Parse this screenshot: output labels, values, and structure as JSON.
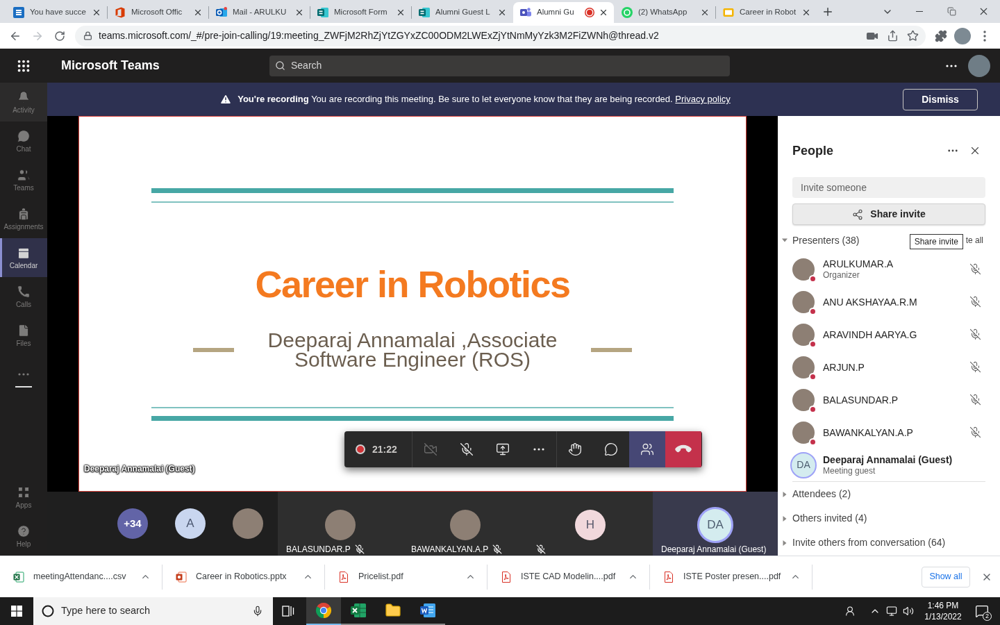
{
  "browser": {
    "tabs": [
      {
        "kind": "sway",
        "title": "You have succe",
        "selected": false,
        "recording": false
      },
      {
        "kind": "office",
        "title": "Microsoft Offic",
        "selected": false,
        "recording": false
      },
      {
        "kind": "outlook",
        "title": "Mail - ARULKU",
        "selected": false,
        "recording": false
      },
      {
        "kind": "forms",
        "title": "Microsoft Form",
        "selected": false,
        "recording": false
      },
      {
        "kind": "forms",
        "title": "Alumni Guest L",
        "selected": false,
        "recording": false
      },
      {
        "kind": "teams",
        "title": "Alumni Gu",
        "selected": true,
        "recording": true
      },
      {
        "kind": "whatsapp",
        "title": "(2) WhatsApp",
        "selected": false,
        "recording": false
      },
      {
        "kind": "slides",
        "title": "Career in Robot",
        "selected": false,
        "recording": false
      }
    ],
    "url": "teams.microsoft.com/_#/pre-join-calling/19:meeting_ZWFjM2RhZjYtZGYxZC00ODM2LWExZjYtNmMyYzk3M2FiZWNh@thread.v2"
  },
  "teams": {
    "app_name": "Microsoft Teams",
    "search": {
      "placeholder": "Search"
    },
    "rail": [
      {
        "kind": "activity",
        "label": "Activity",
        "selected": false,
        "hovered": true
      },
      {
        "kind": "chat",
        "label": "Chat",
        "selected": false,
        "hovered": false
      },
      {
        "kind": "teams",
        "label": "Teams",
        "selected": false,
        "hovered": false
      },
      {
        "kind": "assignments",
        "label": "Assignments",
        "selected": false,
        "hovered": false
      },
      {
        "kind": "calendar",
        "label": "Calendar",
        "selected": true,
        "hovered": false
      },
      {
        "kind": "calls",
        "label": "Calls",
        "selected": false,
        "hovered": false
      },
      {
        "kind": "files",
        "label": "Files",
        "selected": false,
        "hovered": false
      }
    ],
    "rail_bottom": [
      {
        "kind": "apps",
        "label": "Apps",
        "selected": false,
        "hovered": false
      },
      {
        "kind": "help",
        "label": "Help",
        "selected": false,
        "hovered": false
      }
    ]
  },
  "banner": {
    "text": "**You're recording** You are recording this meeting. Be sure to let everyone know that they are being recorded.",
    "link": "Privacy policy",
    "button": "Dismiss"
  },
  "stage": {
    "slide": {
      "title": "Career in Robotics",
      "subtitle": "Deeparaj Annamalai ,Associate Software Engineer (ROS)"
    },
    "presenter_label": "Deeparaj Annamalai (Guest)"
  },
  "call_controls": {
    "recording": true,
    "timer": "21:22",
    "buttons": [
      {
        "kind": "camera",
        "off": true,
        "selected": false,
        "disabled": true
      },
      {
        "kind": "mic",
        "off": true,
        "selected": false,
        "disabled": false
      },
      {
        "kind": "share",
        "selected": false,
        "disabled": false
      },
      {
        "kind": "more",
        "selected": false,
        "disabled": false
      },
      {
        "kind": "hand",
        "selected": false,
        "disabled": false
      },
      {
        "kind": "chat",
        "selected": false,
        "disabled": false
      },
      {
        "kind": "people",
        "selected": true,
        "disabled": false
      },
      {
        "kind": "leave",
        "selected": false,
        "disabled": false
      }
    ]
  },
  "gallery": {
    "overflow": "+34",
    "avatars": [
      {
        "kind": "initials",
        "initials": "A",
        "color": "#c9d6ef"
      },
      {
        "kind": "photo"
      }
    ],
    "tiles": [
      {
        "name": "BALASUNDAR.P",
        "avatar": {
          "kind": "photo"
        },
        "muted": true,
        "speaking": false
      },
      {
        "name": "BAWANKALYAN.A.P",
        "avatar": {
          "kind": "photo"
        },
        "muted": true,
        "speaking": false
      },
      {
        "avatar": {
          "kind": "initials",
          "initials": "H",
          "color": "#f1d8dc"
        },
        "muted": true,
        "speaking": false
      },
      {
        "name": "Deeparaj Annamalai (Guest)",
        "avatar": {
          "kind": "initials",
          "initials": "DA",
          "color": "#d4ecef"
        },
        "muted": false,
        "speaking": true
      }
    ]
  },
  "people": {
    "title": "People",
    "invite": {
      "placeholder": "Invite someone"
    },
    "share_button": "Share invite",
    "tooltip": "Share invite",
    "sections": [
      {
        "label": "Presenters (38)",
        "expanded": true,
        "action": "te all",
        "members": [
          {
            "name": "ARULKUMAR.A",
            "role": "Organizer",
            "avatar": {
              "kind": "photo"
            },
            "busy": true,
            "muted": true,
            "speaking": false
          },
          {
            "name": "ANU AKSHAYAA.R.M",
            "avatar": {
              "kind": "photo"
            },
            "busy": true,
            "muted": true,
            "speaking": false
          },
          {
            "name": "ARAVINDH AARYA.G",
            "avatar": {
              "kind": "photo"
            },
            "busy": true,
            "muted": true,
            "speaking": false
          },
          {
            "name": "ARJUN.P",
            "avatar": {
              "kind": "photo"
            },
            "busy": true,
            "muted": true,
            "speaking": false
          },
          {
            "name": "BALASUNDAR.P",
            "avatar": {
              "kind": "photo"
            },
            "busy": true,
            "muted": true,
            "speaking": false
          },
          {
            "name": "BAWANKALYAN.A.P",
            "avatar": {
              "kind": "photo"
            },
            "busy": true,
            "muted": true,
            "speaking": false
          },
          {
            "name": "Deeparaj Annamalai (Guest)",
            "role": "Meeting guest",
            "avatar": {
              "kind": "initials",
              "initials": "DA",
              "color": "#d4ecef"
            },
            "busy": false,
            "muted": false,
            "speaking": true
          }
        ]
      },
      {
        "label": "Attendees (2)",
        "expanded": false
      },
      {
        "label": "Others invited (4)",
        "expanded": false
      },
      {
        "label": "Invite others from conversation (64)",
        "expanded": false
      }
    ]
  },
  "downloads": {
    "items": [
      {
        "kind": "csv",
        "name": "meetingAttendanc....csv"
      },
      {
        "kind": "pptx",
        "name": "Career in Robotics.pptx"
      },
      {
        "kind": "pdf",
        "name": "Pricelist.pdf"
      },
      {
        "kind": "pdf",
        "name": "ISTE CAD Modelin....pdf"
      },
      {
        "kind": "pdf",
        "name": "ISTE Poster presen....pdf"
      }
    ],
    "show_all": "Show all"
  },
  "taskbar": {
    "search": {
      "placeholder": "Type here to search"
    },
    "apps": [
      {
        "kind": "chrome",
        "selected": true
      },
      {
        "kind": "excel",
        "selected": false
      },
      {
        "kind": "explorer",
        "selected": false
      },
      {
        "kind": "word",
        "selected": false
      }
    ],
    "time": "1:46 PM",
    "date": "1/13/2022",
    "notifications": "2"
  }
}
